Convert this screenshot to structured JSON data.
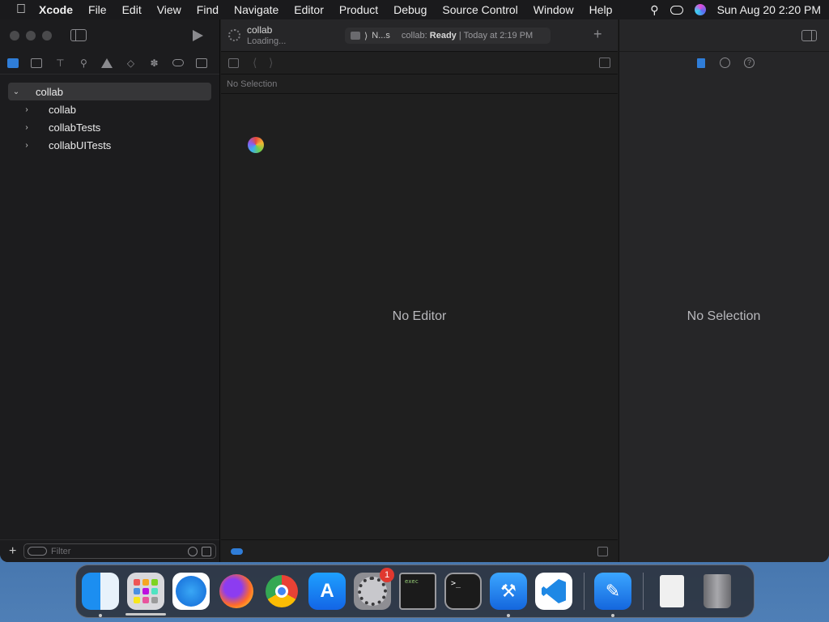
{
  "menubar": {
    "app": "Xcode",
    "items": [
      "File",
      "Edit",
      "View",
      "Find",
      "Navigate",
      "Editor",
      "Product",
      "Debug",
      "Source Control",
      "Window",
      "Help"
    ],
    "clock": "Sun Aug 20  2:20 PM"
  },
  "toolbar": {
    "project_name": "collab",
    "project_status": "Loading...",
    "scheme": "N...s",
    "activity_prefix": "collab:",
    "activity_state": "Ready",
    "activity_time": "| Today at 2:19 PM"
  },
  "navigator": {
    "root": "collab",
    "children": [
      "collab",
      "collabTests",
      "collabUITests"
    ],
    "filter_placeholder": "Filter"
  },
  "editor": {
    "breadcrumb": "No Selection",
    "placeholder": "No Editor"
  },
  "inspector": {
    "placeholder": "No Selection"
  },
  "dock": {
    "settings_badge": "1",
    "exec_label": "exec",
    "terminal_prompt": ">_"
  }
}
